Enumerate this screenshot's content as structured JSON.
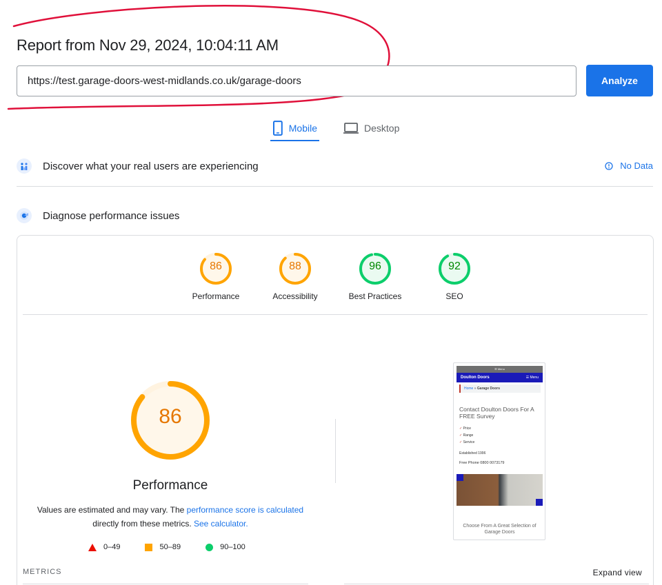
{
  "report": {
    "title": "Report from Nov 29, 2024, 10:04:11 AM",
    "url_value": "https://test.garage-doors-west-midlands.co.uk/garage-doors",
    "analyze_label": "Analyze"
  },
  "tabs": [
    {
      "label": "Mobile",
      "icon": "phone-icon",
      "active": true
    },
    {
      "label": "Desktop",
      "icon": "laptop-icon",
      "active": false
    }
  ],
  "discover": {
    "label": "Discover what your real users are experiencing",
    "status": "No Data",
    "icon": "crux-people-icon"
  },
  "diagnose": {
    "label": "Diagnose performance issues",
    "icon": "lighthouse-icon"
  },
  "categories": [
    {
      "label": "Performance",
      "score": 86,
      "color": "#e67700",
      "ring": "#ffa400"
    },
    {
      "label": "Accessibility",
      "score": 88,
      "color": "#e67700",
      "ring": "#ffa400"
    },
    {
      "label": "Best Practices",
      "score": 96,
      "color": "#008800",
      "ring": "#0cce6b"
    },
    {
      "label": "SEO",
      "score": 92,
      "color": "#008800",
      "ring": "#0cce6b"
    }
  ],
  "performance": {
    "score": 86,
    "title": "Performance",
    "explain_prefix": "Values are estimated and may vary. The ",
    "explain_link1": "performance score is calculated",
    "explain_mid": " directly from these metrics. ",
    "explain_link2": "See calculator.",
    "legend": [
      {
        "shape": "triangle",
        "label": "0–49",
        "color": "#eb0f00"
      },
      {
        "shape": "square",
        "label": "50–89",
        "color": "#ffa400"
      },
      {
        "shape": "circle",
        "label": "90–100",
        "color": "#0cce6b"
      }
    ]
  },
  "screenshot": {
    "top_bar": "☰ Menu",
    "brand": "Doulton Doors",
    "menu": "☰ Menu",
    "crumb_home": "Home",
    "crumb_sep": " » ",
    "crumb_current": "Garage Doors",
    "headline": "Contact Doulton Doors For A FREE Survey",
    "checklist": [
      "Price",
      "Range",
      "Service"
    ],
    "established": "Established 1996",
    "phone": "Free Phone 0800 0073179",
    "caption": "Choose From A Great Selection of Garage Doors"
  },
  "metrics": {
    "label": "METRICS",
    "expand_label": "Expand view"
  },
  "colors": {
    "accent": "#1a73e8",
    "annotation": "#e0103a"
  }
}
